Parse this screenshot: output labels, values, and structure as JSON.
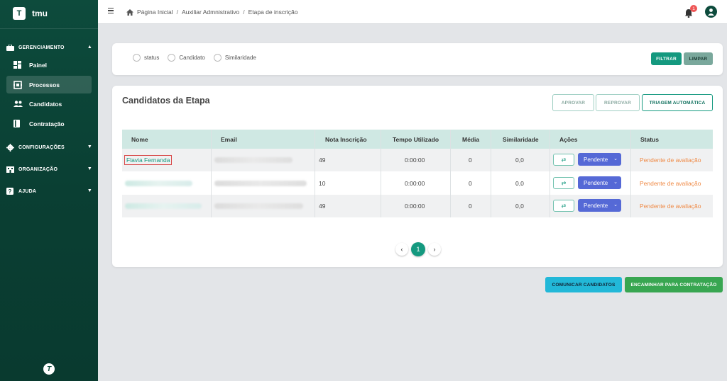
{
  "brand": {
    "logo_letter": "T",
    "name": "tmu"
  },
  "sidebar": {
    "sections": [
      {
        "label": "GERENCIAMENTO",
        "icon": "briefcase-icon"
      },
      {
        "label": "CONFIGURAÇÕES",
        "icon": "gear-icon"
      },
      {
        "label": "ORGANIZAÇÃO",
        "icon": "building-icon"
      },
      {
        "label": "AJUDA",
        "icon": "help-icon"
      }
    ],
    "items": [
      {
        "label": "Painel",
        "icon": "dashboard-icon"
      },
      {
        "label": "Processos",
        "icon": "process-icon",
        "active": true
      },
      {
        "label": "Candidatos",
        "icon": "users-icon"
      },
      {
        "label": "Contratação",
        "icon": "document-icon"
      }
    ],
    "footer_logo": "T"
  },
  "breadcrumb": [
    "Página Inicial",
    "Auxiliar Admnistrativo",
    "Etapa de inscrição"
  ],
  "notifications": {
    "count": "1"
  },
  "filter": {
    "options": [
      "status",
      "Candidato",
      "Similaridade"
    ],
    "filter_label": "FILTRAR",
    "clear_label": "LIMPAR"
  },
  "main": {
    "title": "Candidatos da Etapa",
    "approve_label": "APROVAR",
    "reject_label": "REPROVAR",
    "auto_label": "TRIAGEM AUTOMÁTICA"
  },
  "table": {
    "headers": [
      "Nome",
      "Email",
      "Nota Inscrição",
      "Tempo Utilizado",
      "Média",
      "Similaridade",
      "Ações",
      "Status"
    ],
    "rows": [
      {
        "name": "Flavia Fernanda",
        "score": "49",
        "time": "0:00:00",
        "media": "0",
        "similarity": "0,0",
        "action": "Pendente",
        "status": "Pendente de avaliação"
      },
      {
        "name": "",
        "score": "10",
        "time": "0:00:00",
        "media": "0",
        "similarity": "0,0",
        "action": "Pendente",
        "status": "Pendente de avaliação"
      },
      {
        "name": "",
        "score": "49",
        "time": "0:00:00",
        "media": "0",
        "similarity": "0,0",
        "action": "Pendente",
        "status": "Pendente de avaliação"
      }
    ]
  },
  "pagination": {
    "current": "1"
  },
  "footer_actions": {
    "communicate_label": "COMUNICAR CANDIDATOS",
    "forward_label": "ENCAMINHAR PARA CONTRATAÇÃO"
  },
  "colors": {
    "sidebar": "#0d4b3c",
    "accent": "#14997f",
    "status": "#ef8a46",
    "dropdown": "#5569d6"
  }
}
